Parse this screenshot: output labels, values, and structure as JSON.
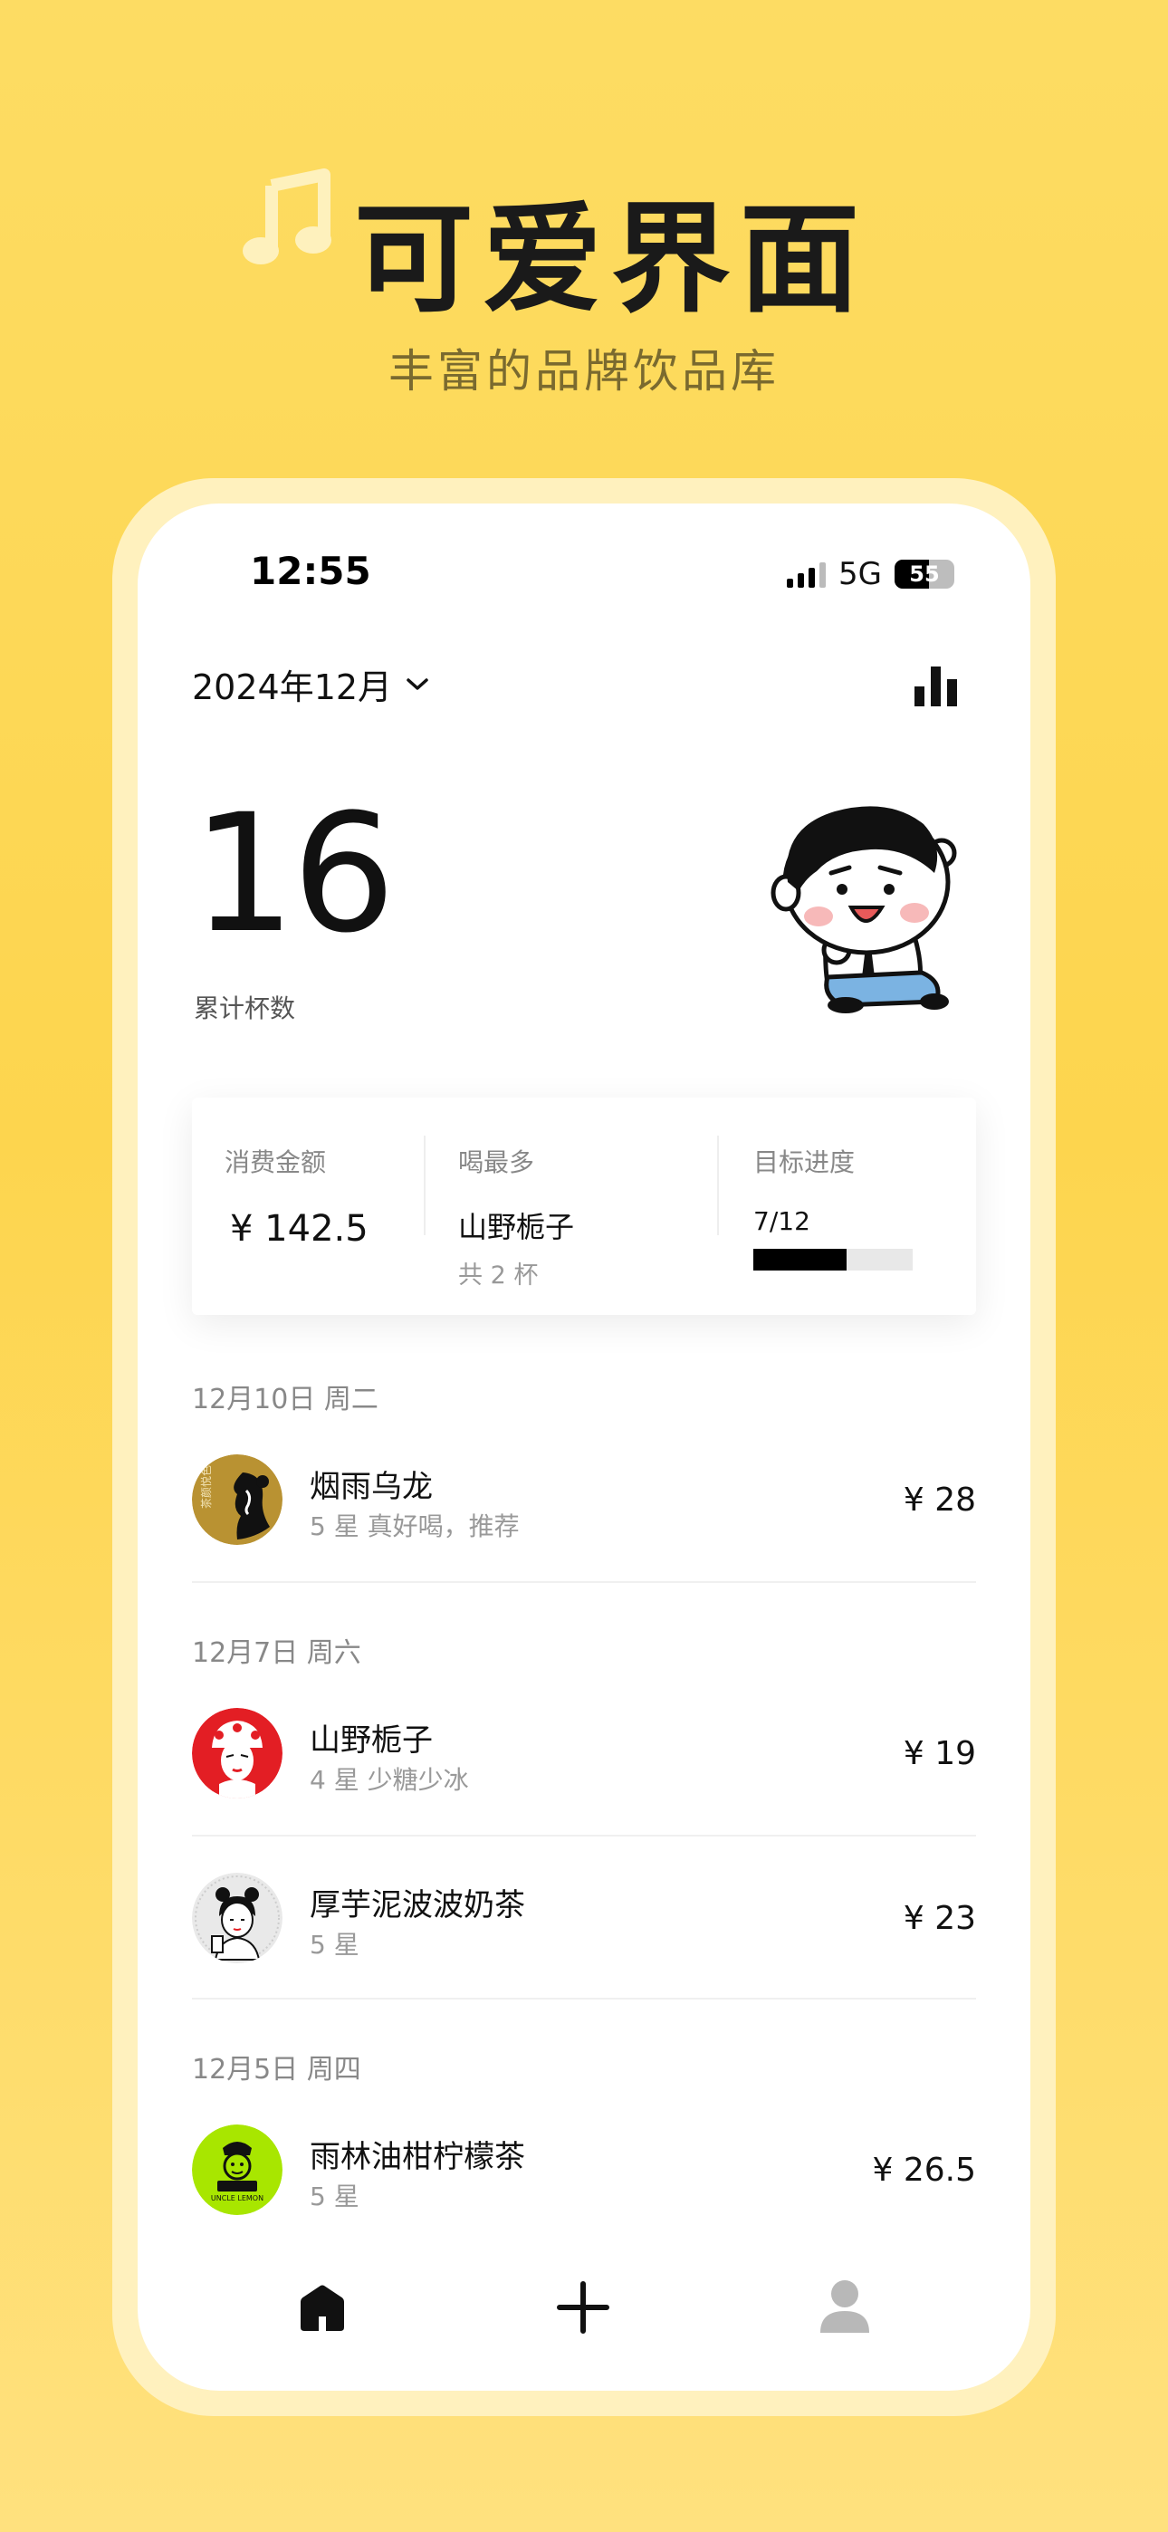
{
  "hero": {
    "title": "可爱界面",
    "subtitle": "丰富的品牌饮品库"
  },
  "status_bar": {
    "time": "12:55",
    "network": "5G",
    "battery": "55"
  },
  "header": {
    "month": "2024年12月"
  },
  "summary": {
    "total_cups": "16",
    "total_cups_label": "累计杯数",
    "spend_label": "消费金额",
    "spend_value": "¥ 142.5",
    "most_label": "喝最多",
    "most_name": "山野栀子",
    "most_count": "共 2 杯",
    "goal_label": "目标进度",
    "goal_text": "7/12",
    "goal_fraction": 0.583
  },
  "days": [
    {
      "date": "12月10日 周二",
      "entries": [
        {
          "name": "烟雨乌龙",
          "note": "5 星 真好喝，推荐",
          "price": "¥ 28",
          "logo": "ink-lady-logo"
        }
      ]
    },
    {
      "date": "12月7日 周六",
      "entries": [
        {
          "name": "山野栀子",
          "note": "4 星 少糖少冰",
          "price": "¥ 19",
          "logo": "opera-mask-logo"
        },
        {
          "name": "厚芋泥波波奶茶",
          "note": "5 星",
          "price": "¥ 23",
          "logo": "girl-portrait-logo"
        }
      ]
    },
    {
      "date": "12月5日 周四",
      "entries": [
        {
          "name": "雨林油柑柠檬茶",
          "note": "5 星",
          "price": "¥ 26.5",
          "logo": "uncle-lemon-logo"
        }
      ]
    }
  ],
  "uncle_logo_text": "UNCLE LEMON",
  "colors": {
    "background": "#FDD54E",
    "frame": "#FFF1BE",
    "accent": "#000000",
    "lime": "#A8E600"
  }
}
